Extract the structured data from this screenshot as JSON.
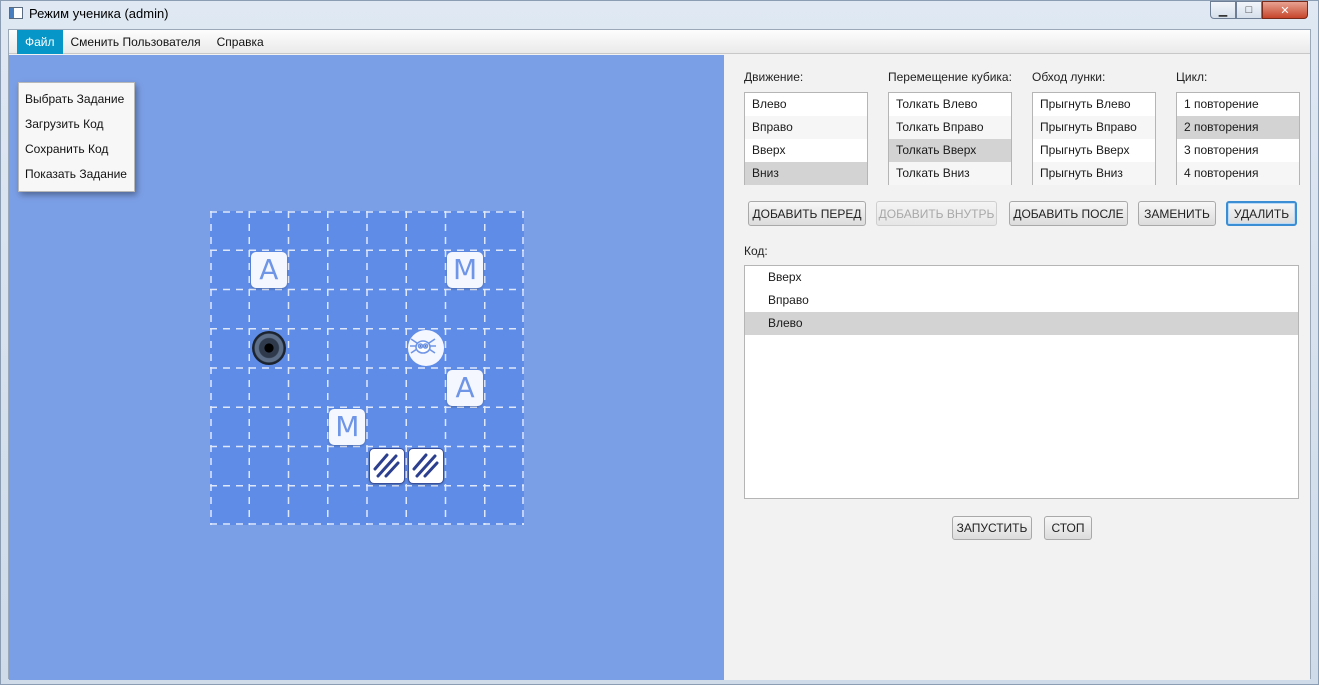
{
  "window": {
    "title": "Режим ученика (admin)",
    "controls": {
      "minimize": "▁",
      "maximize": "□",
      "close": "✕"
    }
  },
  "menubar": {
    "items": [
      "Файл",
      "Сменить Пользователя",
      "Справка"
    ],
    "active_index": 0
  },
  "file_menu": {
    "items": [
      "Выбрать Задание",
      "Загрузить Код",
      "Сохранить Код",
      "Показать Задание"
    ]
  },
  "board": {
    "grid_size": 8,
    "tiles": [
      {
        "letter": "А",
        "row": 1,
        "col": 1
      },
      {
        "letter": "М",
        "row": 1,
        "col": 6
      },
      {
        "letter": "А",
        "row": 4,
        "col": 6
      },
      {
        "letter": "М",
        "row": 5,
        "col": 3
      }
    ],
    "hole": {
      "row": 3,
      "col": 1
    },
    "spider": {
      "row": 3,
      "col": 5
    },
    "striped_blocks": [
      {
        "row": 6,
        "col": 4
      },
      {
        "row": 6,
        "col": 5
      }
    ],
    "colors": {
      "field": "#7b9fe6",
      "board": "#5f8ce6",
      "grid_line": "#dfe8fb",
      "tile_text": "#6f95e6"
    }
  },
  "panel": {
    "groups": [
      {
        "label": "Движение:",
        "items": [
          "Влево",
          "Вправо",
          "Вверх",
          "Вниз"
        ],
        "selected_index": 3
      },
      {
        "label": "Перемещение кубика:",
        "items": [
          "Толкать Влево",
          "Толкать Вправо",
          "Толкать Вверх",
          "Толкать Вниз"
        ],
        "selected_index": 2
      },
      {
        "label": "Обход лунки:",
        "items": [
          "Прыгнуть Влево",
          "Прыгнуть Вправо",
          "Прыгнуть Вверх",
          "Прыгнуть Вниз"
        ],
        "selected_index": -1
      },
      {
        "label": "Цикл:",
        "items": [
          "1 повторение",
          "2 повторения",
          "3 повторения",
          "4 повторения"
        ],
        "selected_index": 1
      }
    ],
    "buttons": {
      "add_before": "ДОБАВИТЬ ПЕРЕД",
      "add_inside": "ДОБАВИТЬ ВНУТРЬ",
      "add_after": "ДОБАВИТЬ ПОСЛЕ",
      "replace": "ЗАМЕНИТЬ",
      "delete": "УДАЛИТЬ"
    },
    "code_label": "Код:",
    "code_lines": [
      "Вверх",
      "Вправо",
      "Влево"
    ],
    "code_selected_index": 2,
    "run_label": "ЗАПУСТИТЬ",
    "stop_label": "СТОП"
  }
}
